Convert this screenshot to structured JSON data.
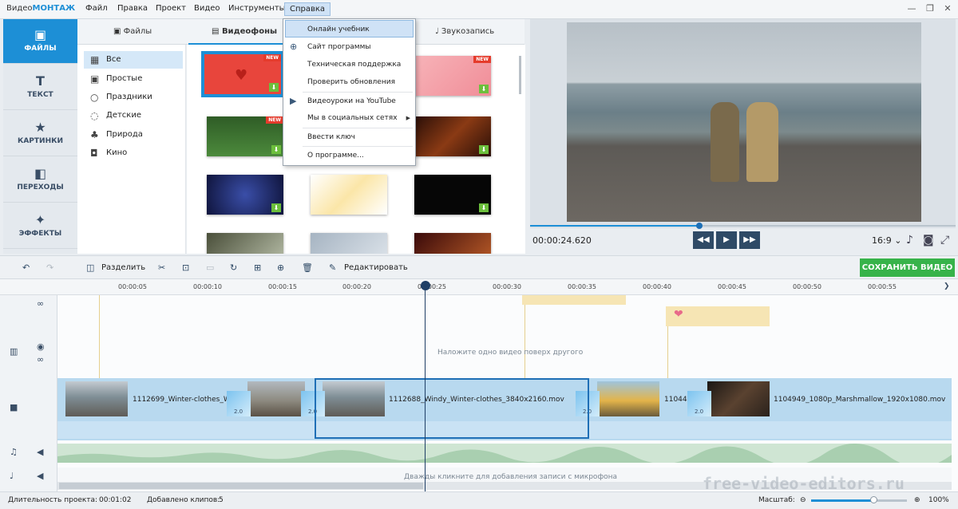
{
  "app": {
    "logo_prefix": "Видео",
    "logo_accent": "МОНТАЖ"
  },
  "menu": [
    "Файл",
    "Правка",
    "Проект",
    "Видео",
    "Инструменты",
    "Справка"
  ],
  "window_controls": [
    "—",
    "❐",
    "✕"
  ],
  "sidebar": [
    {
      "label": "ФАЙЛЫ",
      "icon": "image-icon",
      "active": true
    },
    {
      "label": "ТЕКСТ",
      "icon": "text-icon"
    },
    {
      "label": "КАРТИНКИ",
      "icon": "star-icon"
    },
    {
      "label": "ПЕРЕХОДЫ",
      "icon": "transitions-icon"
    },
    {
      "label": "ЭФФЕКТЫ",
      "icon": "magic-wand-icon"
    }
  ],
  "library_tabs": [
    {
      "label": "Файлы",
      "icon": "image-icon"
    },
    {
      "label": "Видеофоны",
      "icon": "film-icon",
      "active": true
    },
    {
      "label": "Звукозапись",
      "icon": "microphone-icon"
    }
  ],
  "categories": [
    "Все",
    "Простые",
    "Праздники",
    "Детские",
    "Природа",
    "Кино"
  ],
  "new_badge": "NEW",
  "help_menu": [
    {
      "label": "Онлайн учебник",
      "selected": true
    },
    {
      "label": "Сайт программы",
      "icon": "globe-icon"
    },
    {
      "label": "Техническая поддержка"
    },
    {
      "label": "Проверить обновления"
    },
    {
      "label": "Видеоуроки на YouTube",
      "icon": "youtube-icon"
    },
    {
      "label": "Мы в социальных сетях",
      "submenu": true
    },
    {
      "label": "Ввести ключ"
    },
    {
      "label": "О программе..."
    }
  ],
  "player": {
    "timecode": "00:00:24.620",
    "ratio": "16:9"
  },
  "toolbar": {
    "split": "Разделить",
    "edit": "Редактировать",
    "save": "СОХРАНИТЬ ВИДЕО"
  },
  "ruler": [
    "00:00:05",
    "00:00:10",
    "00:00:15",
    "00:00:20",
    "00:00:25",
    "00:00:30",
    "00:00:35",
    "00:00:40",
    "00:00:45",
    "00:00:50",
    "00:00:55"
  ],
  "timeline": {
    "overlay_hint": "Наложите одно видео поверх другого",
    "mic_hint": "Дважды кликните для добавления записи с микрофона",
    "clips": [
      "1112699_Winter-clothes_W",
      "1112688_Windy_Winter-clothes_3840x2160.mov",
      "11044",
      "1104949_1080p_Marshmallow_1920x1080.mov"
    ],
    "transition_label": "2.0"
  },
  "status": {
    "duration_label": "Длительность проекта:",
    "duration": "00:01:02",
    "clips_label": "Добавлено клипов:",
    "clips": "5",
    "zoom_label": "Масштаб:",
    "zoom": "100%"
  },
  "watermark": "free-video-editors.ru",
  "colors": {
    "accent": "#1d8fd6",
    "save": "#37b34a",
    "dark": "#2f4a66"
  }
}
